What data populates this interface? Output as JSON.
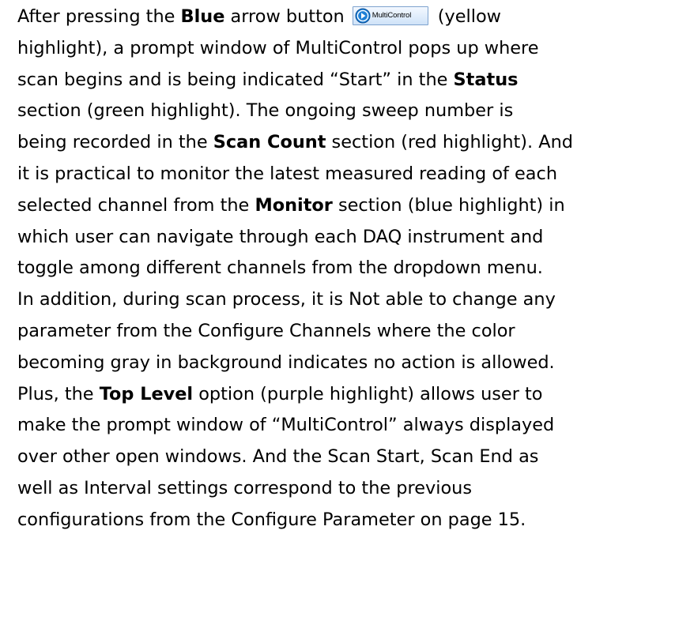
{
  "paragraph": {
    "line1": {
      "before": "After pressing the ",
      "bold": "Blue",
      "after": " arrow button",
      "button_label": "MultiControl",
      "tail": "(yellow"
    },
    "line2": "highlight), a prompt window of MultiControl pops up where",
    "line3": {
      "before": "scan begins and is being indicated “Start” in the ",
      "bold": "Status"
    },
    "line4": "section (green highlight). The ongoing sweep number is",
    "line5": {
      "before": "being recorded in the ",
      "bold": "Scan Count",
      "after": " section (red highlight). And"
    },
    "line6": "it is practical to monitor the latest measured reading of each",
    "line7": {
      "before": "selected channel from the ",
      "bold": "Monitor",
      "after": " section (blue highlight) in"
    },
    "line8": "which user can navigate through each DAQ instrument and",
    "line9": "toggle among different channels from the dropdown menu.",
    "line10": "In addition, during scan process, it is Not able to change any",
    "line11": "parameter from the Configure Channels where the color",
    "line12": "becoming gray in background indicates no action is allowed.",
    "line13": {
      "before": "Plus, the ",
      "bold": "Top Level",
      "after": " option (purple highlight) allows user to"
    },
    "line14": "make the prompt window of “MultiControl” always displayed",
    "line15": "over other open windows. And the Scan Start, Scan End as",
    "line16": "well as Interval settings correspond to the previous",
    "line17": "configurations from the Configure Parameter on page 15."
  },
  "icons": {
    "button_icon": "play-arrow-circle-icon"
  },
  "colors": {
    "text": "#000000",
    "button_border": "#7da2ce",
    "button_icon_fill": "#1e7fd6"
  }
}
